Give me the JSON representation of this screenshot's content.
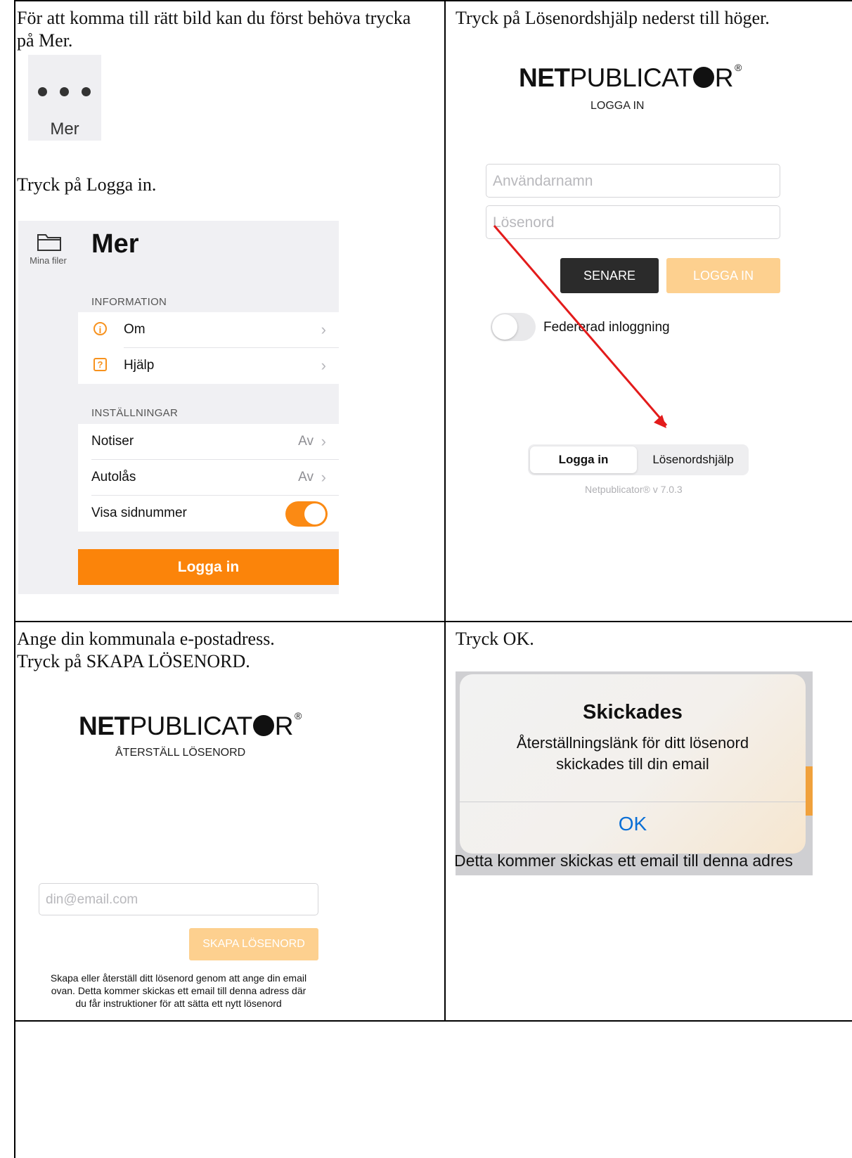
{
  "cells": {
    "c1": {
      "caption": "För att komma till rätt bild kan du först behöva trycka på Mer.",
      "mer_button_label": "Mer",
      "caption2": "Tryck på Logga in.",
      "panel": {
        "side_label": "Mina filer",
        "title": "Mer",
        "section_info": "INFORMATION",
        "row_om": "Om",
        "row_hjalp": "Hjälp",
        "section_settings": "INSTÄLLNINGAR",
        "row_notiser": "Notiser",
        "row_notiser_value": "Av",
        "row_autolas": "Autolås",
        "row_autolas_value": "Av",
        "row_sidnummer": "Visa sidnummer",
        "login_button": "Logga in"
      }
    },
    "c2": {
      "caption": "Tryck på Lösenordshjälp nederst till höger.",
      "logo_bold": "NET",
      "logo_rest_1": "PUBLICAT",
      "logo_rest_2": "R",
      "logo_reg": "®",
      "subtitle": "LOGGA IN",
      "username_placeholder": "Användarnamn",
      "password_placeholder": "Lösenord",
      "later_button": "SENARE",
      "login_button": "LOGGA IN",
      "federated_label": "Federerad inloggning",
      "tab_login": "Logga in",
      "tab_help": "Lösenordshjälp",
      "version": "Netpublicator® v 7.0.3"
    },
    "c3": {
      "caption_line1": "Ange din kommunala e-postadress.",
      "caption_line2": "Tryck på SKAPA LÖSENORD.",
      "subtitle": "ÅTERSTÄLL LÖSENORD",
      "email_placeholder": "din@email.com",
      "create_button": "SKAPA LÖSENORD",
      "info_line1": "Skapa eller återställ ditt lösenord genom att ange din email",
      "info_line2": "ovan. Detta kommer skickas ett email till denna adress där",
      "info_line3": "du får instruktioner för att sätta ett nytt lösenord"
    },
    "c4": {
      "caption": "Tryck OK.",
      "dialog_title": "Skickades",
      "dialog_line1": "Återställningslänk för ditt lösenord",
      "dialog_line2": "skickades till din email",
      "ok_button": "OK",
      "background_text": "Detta kommer skickas ett email till denna adres"
    }
  }
}
